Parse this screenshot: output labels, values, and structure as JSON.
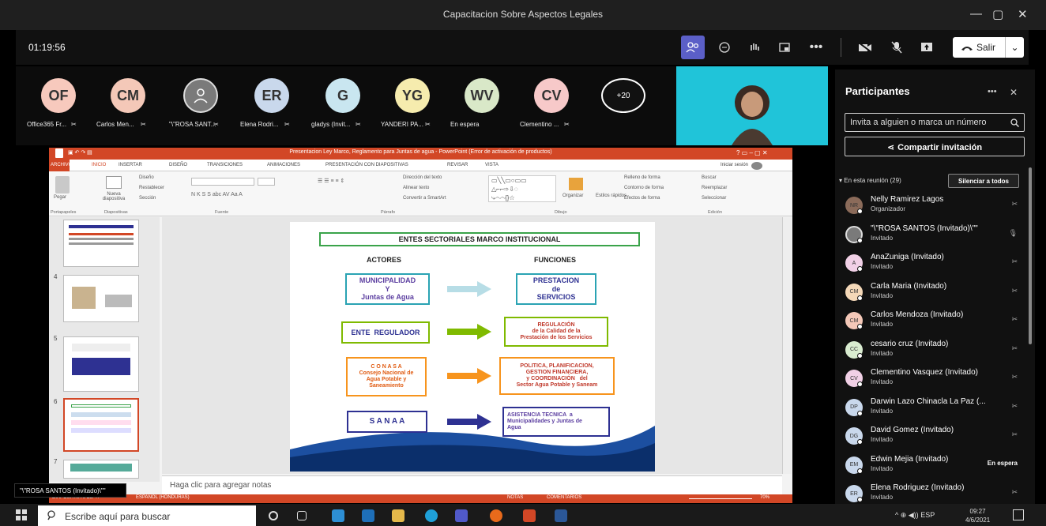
{
  "window": {
    "title": "Capacitacion Sobre Aspectos Legales",
    "min": "—",
    "max": "▢",
    "close": "✕"
  },
  "meeting": {
    "timer": "01:19:56",
    "leave_label": "Salir",
    "chevron": "⌄"
  },
  "participants_strip": [
    {
      "initials": "OF",
      "name": "Office365 Fr...",
      "color": "#f7c9bd"
    },
    {
      "initials": "CM",
      "name": "Carlos Men...",
      "color": "#f4c8b8"
    },
    {
      "initials": "",
      "name": "\"\\\"ROSA SANT...",
      "color": "#7a7a7a"
    },
    {
      "initials": "ER",
      "name": "Elena Rodri...",
      "color": "#c9d8ec"
    },
    {
      "initials": "G",
      "name": "gladys (Invit...",
      "color": "#c9e6f0"
    },
    {
      "initials": "YG",
      "name": "YANDERI PA...",
      "color": "#f6ecae"
    },
    {
      "initials": "WV",
      "name": "En espera",
      "color": "#d9e8c8"
    },
    {
      "initials": "CV",
      "name": "Clementino ...",
      "color": "#f7c9c9"
    }
  ],
  "more_count": "+20",
  "panel": {
    "title": "Participantes",
    "invite_placeholder": "Invita a alguien o marca un número",
    "share_label": "Compartir invitación",
    "in_meeting": "En esta reunión (29)",
    "mute_all": "Silenciar a todos",
    "list": [
      {
        "initials": "NR",
        "name": "Nelly Ramirez Lagos",
        "role": "Organizador",
        "status": "",
        "color": "#8b6b5a"
      },
      {
        "initials": "",
        "name": "\"\\\"ROSA SANTOS (Invitado)\\\"\"",
        "role": "Invitado",
        "status": "",
        "color": "#7a7a7a"
      },
      {
        "initials": "A",
        "name": "AnaZuniga (Invitado)",
        "role": "Invitado",
        "status": "",
        "color": "#f1d0e6"
      },
      {
        "initials": "CM",
        "name": "Carla Maria (Invitado)",
        "role": "Invitado",
        "status": "",
        "color": "#f4d8b8"
      },
      {
        "initials": "CM",
        "name": "Carlos Mendoza (Invitado)",
        "role": "Invitado",
        "status": "",
        "color": "#f4c8b8"
      },
      {
        "initials": "CC",
        "name": "cesario cruz (Invitado)",
        "role": "Invitado",
        "status": "",
        "color": "#d9ecd0"
      },
      {
        "initials": "CV",
        "name": "Clementino Vasquez (Invitado)",
        "role": "Invitado",
        "status": "",
        "color": "#f1d0e6"
      },
      {
        "initials": "DP",
        "name": "Darwin Lazo Chinacla La Paz (...",
        "role": "Invitado",
        "status": "",
        "color": "#c9d8ec"
      },
      {
        "initials": "DG",
        "name": "David Gomez (Invitado)",
        "role": "Invitado",
        "status": "",
        "color": "#c9d8ec"
      },
      {
        "initials": "EM",
        "name": "Edwin Mejia (Invitado)",
        "role": "Invitado",
        "status": "En espera",
        "color": "#c9d8ec"
      },
      {
        "initials": "ER",
        "name": "Elena Rodriguez (Invitado)",
        "role": "Invitado",
        "status": "",
        "color": "#c9d8ec"
      }
    ]
  },
  "ppt": {
    "title": "Presentacion Ley Marco, Reglamento para Juntas de agua - PowerPoint (Error de activación de productos)",
    "tabs": [
      "ARCHIVO",
      "INICIO",
      "INSERTAR",
      "DISEÑO",
      "TRANSICIONES",
      "ANIMACIONES",
      "PRESENTACIÓN CON DIAPOSITIVAS",
      "REVISAR",
      "VISTA"
    ],
    "signin": "Iniciar sesión",
    "groups": [
      "Portapapeles",
      "Diapositivas",
      "Fuente",
      "Párrafo",
      "Dibujo",
      "Edición"
    ],
    "ribbon_items": {
      "pegar": "Pegar",
      "nueva": "Nueva diapositiva",
      "diseno": "Diseño",
      "restablecer": "Restablecer",
      "seccion": "Sección",
      "buscar": "Buscar",
      "reemplazar": "Reemplazar",
      "seleccionar": "Seleccionar",
      "organizar": "Organizar",
      "estilos": "Estilos rápidos",
      "relleno": "Relleno de forma",
      "contorno": "Contorno de forma",
      "efectos": "Efectos de forma",
      "direccion": "Dirección del texto",
      "alinear": "Alinear texto",
      "smartart": "Convertir a SmartArt"
    },
    "thumb_numbers": [
      "4",
      "5",
      "6",
      "7"
    ],
    "notes": "Haga clic para agregar notas",
    "status": {
      "slide": "DIAPOSITIVA 6 DE 47",
      "lang": "ESPAÑOL (HONDURAS)",
      "notas": "NOTAS",
      "comentarios": "COMENTARIOS",
      "zoom": "70%"
    }
  },
  "slide": {
    "heading": "ENTES SECTORIALES MARCO INSTITUCIONAL",
    "col_actores": "ACTORES",
    "col_funciones": "FUNCIONES",
    "rows": [
      {
        "actor": "MUNICIPALIDAD\nY\nJuntas de Agua",
        "funcion": "PRESTACION\nde\nSERVICIOS",
        "arrow_color": "#b7dde6"
      },
      {
        "actor": "ENTE  REGULADOR",
        "funcion": "REGULACIÓN\nde la Calidad de la\nPrestación de los Servicios",
        "arrow_color": "#7fba00"
      },
      {
        "actor": "C O N A S A\nConsejo Nacional de\nAgua Potable y\nSaneamiento",
        "funcion": "POLITICA, PLANIFICACION,\nGESTION FINANCIERA,\ny COORDINACIÓN   del\nSector Agua Potable y Saneam",
        "arrow_color": "#f7941d"
      },
      {
        "actor": "S A N A A",
        "funcion": "ASISTENCIA TECNICA  a\nMunicipalidades y Juntas de\nAgua",
        "arrow_color": "#2e3192"
      }
    ]
  },
  "speaker_overlay": "\"\\\"ROSA SANTOS (Invitado)\\\"\"",
  "taskbar": {
    "search": "Escribe aquí para buscar",
    "lang": "ESP",
    "time": "09:27",
    "date": "4/6/2021"
  }
}
